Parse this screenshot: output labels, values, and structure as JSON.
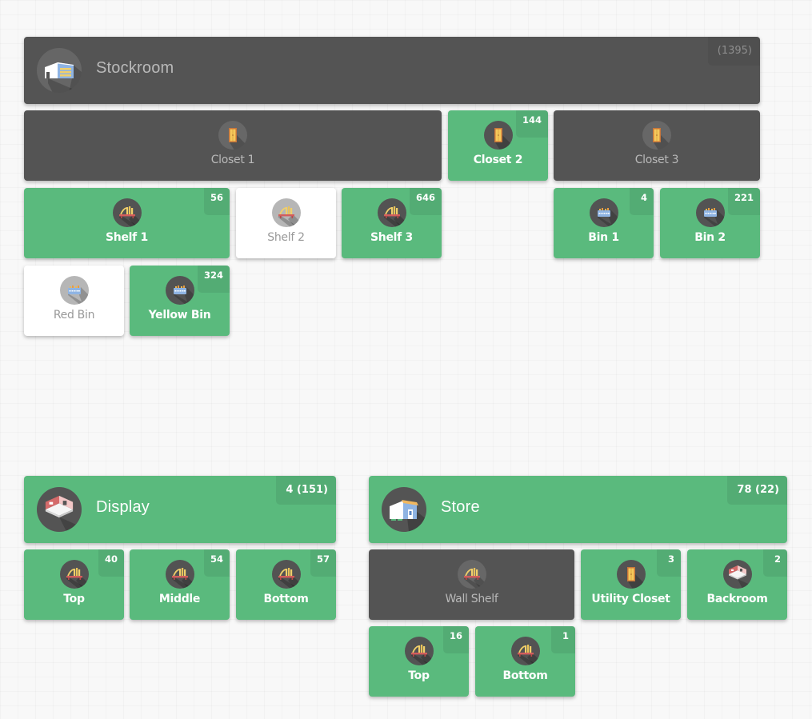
{
  "colors": {
    "active_green": "#5aba7d",
    "inactive_dark": "#545454",
    "empty_white": "#ffffff"
  },
  "stockroom": {
    "title": "Stockroom",
    "icon": "warehouse-icon",
    "badge": "(1395)",
    "state": "dark",
    "closets": [
      {
        "label": "Closet 1",
        "icon": "closet-icon",
        "badge": "",
        "state": "dark"
      },
      {
        "label": "Closet 2",
        "icon": "closet-icon",
        "badge": "144",
        "state": "green"
      },
      {
        "label": "Closet 3",
        "icon": "closet-icon",
        "badge": "",
        "state": "dark"
      }
    ],
    "closet1_children": [
      {
        "label": "Shelf 1",
        "icon": "shelf-icon",
        "badge": "56",
        "state": "green"
      },
      {
        "label": "Shelf 2",
        "icon": "shelf-icon",
        "badge": "",
        "state": "white"
      },
      {
        "label": "Shelf 3",
        "icon": "shelf-icon",
        "badge": "646",
        "state": "green"
      },
      {
        "label": "Red Bin",
        "icon": "bin-icon",
        "badge": "",
        "state": "white"
      },
      {
        "label": "Yellow Bin",
        "icon": "bin-icon",
        "badge": "324",
        "state": "green"
      }
    ],
    "closet3_children": [
      {
        "label": "Bin 1",
        "icon": "bin-icon",
        "badge": "4",
        "state": "green"
      },
      {
        "label": "Bin 2",
        "icon": "bin-icon",
        "badge": "221",
        "state": "green"
      }
    ]
  },
  "display": {
    "title": "Display",
    "icon": "room-icon",
    "badge": "4 (151)",
    "state": "green",
    "children": [
      {
        "label": "Top",
        "icon": "shelf-icon",
        "badge": "40",
        "state": "green"
      },
      {
        "label": "Middle",
        "icon": "shelf-icon",
        "badge": "54",
        "state": "green"
      },
      {
        "label": "Bottom",
        "icon": "shelf-icon",
        "badge": "57",
        "state": "green"
      }
    ]
  },
  "store": {
    "title": "Store",
    "icon": "store-building-icon",
    "badge": "78 (22)",
    "state": "green",
    "children": [
      {
        "label": "Wall Shelf",
        "icon": "shelf-icon",
        "badge": "",
        "state": "dark"
      },
      {
        "label": "Utility Closet",
        "icon": "closet-icon",
        "badge": "3",
        "state": "green"
      },
      {
        "label": "Backroom",
        "icon": "room-icon",
        "badge": "2",
        "state": "green"
      }
    ],
    "wall_shelf_children": [
      {
        "label": "Top",
        "icon": "shelf-icon",
        "badge": "16",
        "state": "green"
      },
      {
        "label": "Bottom",
        "icon": "shelf-icon",
        "badge": "1",
        "state": "green"
      }
    ]
  }
}
